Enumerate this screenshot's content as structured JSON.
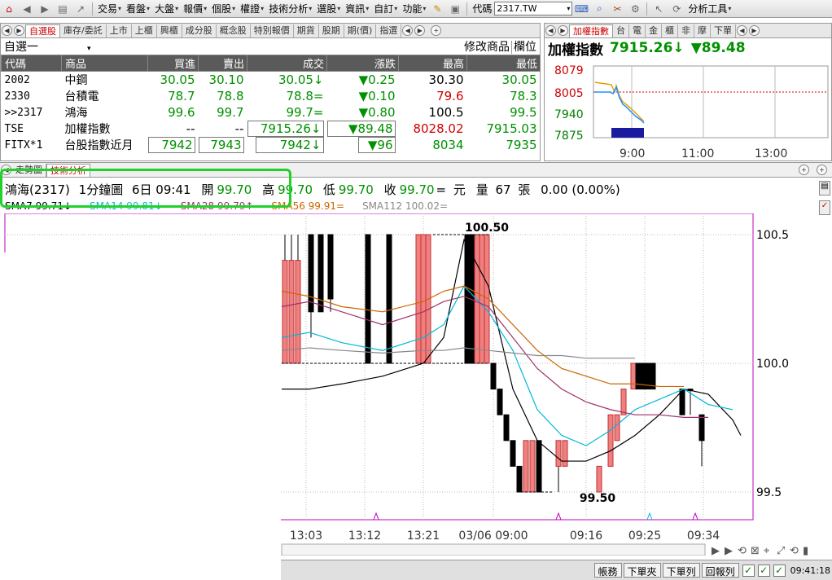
{
  "menubar": {
    "items": [
      "交易",
      "看盤",
      "大盤",
      "報價",
      "個股",
      "權證",
      "技術分析",
      "選股",
      "資訊",
      "自訂",
      "功能"
    ],
    "code_label": "代碼",
    "code_value": "2317.TW",
    "analysis_tools": "分析工具"
  },
  "quote_tabs": [
    "自選股",
    "庫存/委託",
    "上市",
    "上櫃",
    "興櫃",
    "成分股",
    "概念股",
    "特別報價",
    "期貨",
    "股期",
    "期(價)",
    "指選"
  ],
  "quote": {
    "group_name": "自選一",
    "modify_label": "修改商品",
    "columns_label": "欄位",
    "headers": [
      "代碼",
      "商品",
      "買進",
      "賣出",
      "成交",
      "漲跌",
      "最高",
      "最低"
    ],
    "rows": [
      {
        "code": "2002",
        "name": "中鋼",
        "bid": "30.05",
        "ask": "30.10",
        "last": "30.05",
        "last_mark": "↓",
        "chg": "▼0.25",
        "high": "30.30",
        "low": "30.05"
      },
      {
        "code": "2330",
        "name": "台積電",
        "bid": "78.7",
        "ask": "78.8",
        "last": "78.8",
        "last_mark": "=",
        "chg": "▼0.10",
        "high": "79.6",
        "low": "78.3"
      },
      {
        "code": ">>2317",
        "name": "鴻海",
        "bid": "99.6",
        "ask": "99.7",
        "last": "99.7",
        "last_mark": "=",
        "chg": "▼0.80",
        "high": "100.5",
        "low": "99.5"
      },
      {
        "code": "TSE",
        "name": "加權指數",
        "bid": "--",
        "ask": "--",
        "last": "7915.26",
        "last_mark": "↓",
        "chg": "▼89.48",
        "high": "8028.02",
        "low": "7915.03"
      },
      {
        "code": "FITX*1",
        "name": "台股指數近月",
        "bid": "7942",
        "ask": "7943",
        "last": "7942",
        "last_mark": "↓",
        "chg": "▼96",
        "high": "8034",
        "low": "7935"
      }
    ]
  },
  "index_tabs": [
    "加權指數",
    "台",
    "電",
    "金",
    "櫃",
    "非",
    "摩",
    "下單"
  ],
  "index": {
    "title": "加權指數",
    "value": "7915.26↓",
    "change": "▼89.48",
    "y_ticks": [
      "8079",
      "8005",
      "7940",
      "7875"
    ],
    "x_ticks": [
      "9:00",
      "11:00",
      "13:00"
    ]
  },
  "chart_tabs": [
    "走勢圖",
    "技術分析"
  ],
  "chart_info": {
    "symbol": "鴻海(2317)",
    "interval": "1分鐘圖",
    "date_time": "6日 09:41",
    "open_label": "開",
    "open": "99.70",
    "high_label": "高",
    "high": "99.70",
    "low_label": "低",
    "low": "99.70",
    "close_label": "收",
    "close": "99.70",
    "close_mark": "=",
    "unit": "元",
    "volume_label": "量",
    "volume": "67",
    "volume_unit": "張",
    "change": "0.00 (0.00%)"
  },
  "ma_legend": [
    {
      "label": "SMA7 99.71",
      "mark": "↓",
      "color": "#000000"
    },
    {
      "label": "SMA14 99.81",
      "mark": "↓",
      "color": "#00b8d8"
    },
    {
      "label": "SMA28 99.79",
      "mark": "↑",
      "color": "#a0306a"
    },
    {
      "label": "SMA56 99.91",
      "mark": "=",
      "color": "#cc6600"
    },
    {
      "label": "SMA112 100.02",
      "mark": "=",
      "color": "#888888"
    }
  ],
  "chart_data": {
    "type": "candlestick",
    "y_ticks": [
      "100.5",
      "100.0",
      "99.5"
    ],
    "ylim": [
      99.5,
      100.5
    ],
    "x_ticks": [
      "13:03",
      "13:12",
      "13:21",
      "03/06 09:00",
      "09:16",
      "09:25",
      "09:34"
    ],
    "annotations": {
      "max": "100.50",
      "min": "99.50"
    },
    "series": [
      {
        "name": "SMA7",
        "color": "#000000",
        "values": [
          99.9,
          99.9,
          99.92,
          99.95,
          100.0,
          100.1,
          100.48,
          100.3,
          99.9,
          99.7,
          99.62,
          99.62,
          99.66,
          99.72,
          99.8,
          99.9,
          99.88,
          99.78,
          99.72
        ]
      },
      {
        "name": "SMA14",
        "color": "#00b8d8",
        "values": [
          100.1,
          100.12,
          100.08,
          100.05,
          100.1,
          100.15,
          100.3,
          100.2,
          100.05,
          99.82,
          99.72,
          99.68,
          99.74,
          99.82,
          99.86,
          99.9,
          99.84,
          99.82
        ]
      },
      {
        "name": "SMA28",
        "color": "#a0306a",
        "values": [
          100.22,
          100.24,
          100.2,
          100.15,
          100.2,
          100.24,
          100.26,
          100.22,
          100.1,
          99.98,
          99.9,
          99.85,
          99.82,
          99.8,
          99.8,
          99.79,
          99.79
        ]
      },
      {
        "name": "SMA56",
        "color": "#cc6600",
        "values": [
          100.28,
          100.26,
          100.22,
          100.2,
          100.24,
          100.28,
          100.3,
          100.25,
          100.15,
          100.05,
          99.98,
          99.95,
          99.92,
          99.92,
          99.91,
          99.91
        ]
      },
      {
        "name": "SMA112",
        "color": "#888888",
        "values": [
          100.05,
          100.06,
          100.05,
          100.04,
          100.05,
          100.05,
          100.06,
          100.05,
          100.04,
          100.03,
          100.03,
          100.02,
          100.02,
          100.02
        ]
      }
    ]
  },
  "status_bar": {
    "buttons": [
      "帳務",
      "下單夾",
      "下單列",
      "回報列"
    ],
    "clock": "09:41:18"
  }
}
